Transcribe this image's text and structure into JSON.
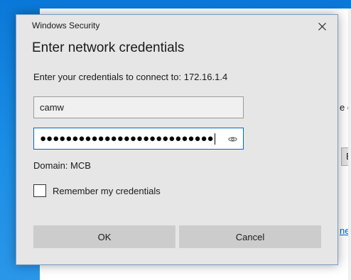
{
  "background": {
    "partial_text": "e co",
    "partial_button": "B",
    "partial_link": "ner"
  },
  "dialog": {
    "caption": "Windows Security",
    "heading": "Enter network credentials",
    "prompt": "Enter your credentials to connect to: 172.16.1.4",
    "username_value": "camw",
    "password_masked": "●●●●●●●●●●●●●●●●●●●●●●●●●●●",
    "domain_text": "Domain: MCB",
    "remember_label": "Remember my credentials",
    "remember_checked": false,
    "ok_label": "OK",
    "cancel_label": "Cancel"
  },
  "icons": {
    "close": "close-icon",
    "reveal": "eye-icon"
  },
  "colors": {
    "desktop": "#0a78d8",
    "dialog_bg": "#e6e6e6",
    "button_bg": "#cccccc",
    "focus_border": "#0067c0"
  }
}
